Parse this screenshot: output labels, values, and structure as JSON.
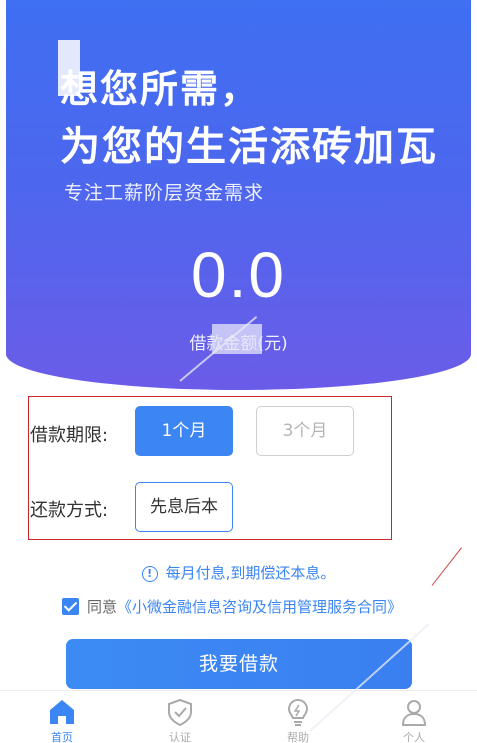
{
  "hero": {
    "headline_line1": "想您所需，",
    "headline_line2": "为您的生活添砖加瓦",
    "subtitle": "专注工薪阶层资金需求",
    "amount": "0.0",
    "amount_label": "借款金额(元)"
  },
  "options": {
    "term_label": "借款期限:",
    "term_options": [
      {
        "label": "1个月",
        "selected": true
      },
      {
        "label": "3个月",
        "selected": false
      }
    ],
    "repay_label": "还款方式:",
    "repay_value": "先息后本"
  },
  "info": {
    "icon": "info-icon",
    "text": "每月付息,到期偿还本息。"
  },
  "agreement": {
    "checked": true,
    "prefix": "同意",
    "contract": "《小微金融信息咨询及信用管理服务合同》"
  },
  "main_button": "我要借款",
  "tabbar": {
    "items": [
      {
        "label": "首页",
        "icon": "home-icon",
        "active": true
      },
      {
        "label": "认证",
        "icon": "shield-icon",
        "active": false
      },
      {
        "label": "帮助",
        "icon": "lightbulb-icon",
        "active": false
      },
      {
        "label": "个人",
        "icon": "person-icon",
        "active": false
      }
    ]
  },
  "colors": {
    "accent": "#3b86f3",
    "hero_top": "#3f6ff2",
    "hero_bottom": "#6b5ce8",
    "highlight_border": "#c62828"
  }
}
